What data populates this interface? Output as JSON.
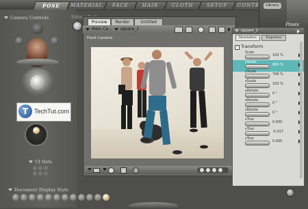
{
  "tabs": [
    {
      "label": "POSE",
      "active": true
    },
    {
      "label": "MATERIAL",
      "active": false
    },
    {
      "label": "FACE",
      "active": false
    },
    {
      "label": "HAIR",
      "active": false
    },
    {
      "label": "CLOTH",
      "active": false
    },
    {
      "label": "SETUP",
      "active": false
    },
    {
      "label": "CONTE",
      "active": false
    }
  ],
  "left_panel": {
    "camera_controls_label": "Camera Controls",
    "editing_tools_label": "Editing Tools",
    "ui_dots_label": "UI Dots",
    "doc_display_label": "Document Display Style"
  },
  "watermark": {
    "letter": "T",
    "text": "TechTut.com"
  },
  "document": {
    "tabs": [
      "Preview",
      "Render",
      "Untitled"
    ],
    "active_tab": "Preview",
    "camera_select": "Main Ca...",
    "figure_select": "square_1",
    "camera_label": "Front Camera"
  },
  "library": {
    "title": "Library",
    "category": "Poses"
  },
  "properties": {
    "figure_select": "square_1",
    "tabs": [
      "Parameters",
      "Properties"
    ],
    "group_label": "Transform",
    "params": [
      {
        "label": "Scale",
        "value": "100 %",
        "selected": false
      },
      {
        "label": "xScale",
        "value": "800 %",
        "selected": true
      },
      {
        "label": "yScale",
        "value": "796 %",
        "selected": false
      },
      {
        "label": "zScale",
        "value": "100 %",
        "selected": false
      },
      {
        "label": "yRotate",
        "value": "0 °",
        "selected": false
      },
      {
        "label": "xRotate",
        "value": "0 °",
        "selected": false
      },
      {
        "label": "zRotate",
        "value": "0 °",
        "selected": false
      },
      {
        "label": "xTran",
        "value": "0.000",
        "selected": false
      },
      {
        "label": "yTran",
        "value": "-0.017",
        "selected": false
      },
      {
        "label": "zTran",
        "value": "0.000",
        "selected": false
      }
    ]
  },
  "colors": {
    "selection": "#5fb8b8",
    "accent": "#1a7fc4"
  }
}
